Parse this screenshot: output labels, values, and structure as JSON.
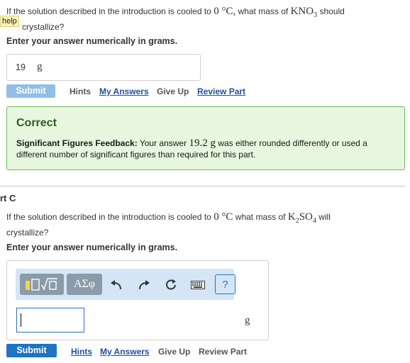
{
  "part_b": {
    "question_prefix": "If the solution described in the introduction is cooled to",
    "temp_value": "0",
    "temp_unit": "°C,",
    "question_mid": "what mass of",
    "compound_main": "KNO",
    "compound_sub": "3",
    "question_suffix_1": "should",
    "question_suffix_2": "crystallize?",
    "instruction": "Enter your answer numerically in grams.",
    "answer_value": "19",
    "answer_unit": "g",
    "submit_label": "Submit",
    "hints_label": "Hints",
    "my_answers_label": "My Answers",
    "give_up_label": "Give Up",
    "review_part_label": "Review Part"
  },
  "help_tag": "help",
  "feedback": {
    "title": "Correct",
    "label": "Significant Figures Feedback:",
    "text_a": "Your answer",
    "value": "19.2",
    "unit": "g",
    "text_b": "was either rounded differently or used a different number of significant figures than required for this part."
  },
  "part_c": {
    "label": "rt C",
    "question_prefix": "If the solution described in the introduction is cooled to",
    "temp_value": "0",
    "temp_unit": "°C",
    "question_mid": "what mass of",
    "compound_a": "K",
    "compound_a_sub": "2",
    "compound_b": "SO",
    "compound_b_sub": "4",
    "question_suffix_1": "will",
    "question_suffix_2": "crystallize?",
    "instruction": "Enter your answer numerically in grams.",
    "toolbar": {
      "templates_icon": "templates-icon",
      "greek_label": "ΑΣφ",
      "undo_icon": "undo-icon",
      "redo_icon": "redo-icon",
      "reset_icon": "reset-icon",
      "keyboard_icon": "keyboard-icon",
      "help_label": "?"
    },
    "input_value": "",
    "unit": "g",
    "submit_label": "Submit",
    "hints_label": "Hints",
    "my_answers_label": "My Answers",
    "give_up_label": "Give Up",
    "review_part_label": "Review Part"
  },
  "colors": {
    "submit_disabled": "#8fbfe6",
    "submit_active": "#1f72c6",
    "correct_bg": "#e6f6df",
    "correct_border": "#6fbb58",
    "link": "#1f4f9c"
  }
}
